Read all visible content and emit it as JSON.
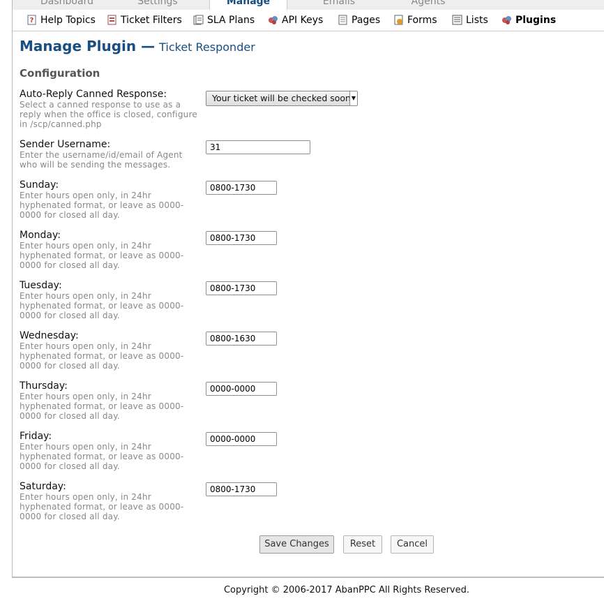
{
  "tabs": [
    {
      "label": "Dashboard"
    },
    {
      "label": "Settings"
    },
    {
      "label": "Manage",
      "active": true
    },
    {
      "label": "Emails"
    },
    {
      "label": "Agents"
    }
  ],
  "subnav": [
    {
      "label": "Help Topics",
      "icon": "help-topics-icon"
    },
    {
      "label": "Ticket Filters",
      "icon": "ticket-filters-icon"
    },
    {
      "label": "SLA Plans",
      "icon": "sla-plans-icon"
    },
    {
      "label": "API Keys",
      "icon": "api-keys-icon"
    },
    {
      "label": "Pages",
      "icon": "pages-icon"
    },
    {
      "label": "Forms",
      "icon": "forms-icon"
    },
    {
      "label": "Lists",
      "icon": "lists-icon"
    },
    {
      "label": "Plugins",
      "icon": "plugins-icon",
      "active": true
    }
  ],
  "page": {
    "title": "Manage Plugin —",
    "subtitle": "Ticket Responder",
    "section": "Configuration"
  },
  "fields": {
    "auto_reply": {
      "label": "Auto-Reply Canned Response:",
      "hint": "Select a canned response to use as a reply when the office is closed, configure in /scp/canned.php",
      "value": "Your ticket will be checked soon"
    },
    "sender": {
      "label": "Sender Username:",
      "hint": "Enter the username/id/email of Agent who will be sending the messages.",
      "value": "31"
    },
    "days": [
      {
        "label": "Sunday:",
        "value": "0800-1730"
      },
      {
        "label": "Monday:",
        "value": "0800-1730"
      },
      {
        "label": "Tuesday:",
        "value": "0800-1730"
      },
      {
        "label": "Wednesday:",
        "value": "0800-1630"
      },
      {
        "label": "Thursday:",
        "value": "0000-0000"
      },
      {
        "label": "Friday:",
        "value": "0000-0000"
      },
      {
        "label": "Saturday:",
        "value": "0800-1730"
      }
    ],
    "day_hint": "Enter hours open only, in 24hr hyphenated format, or leave as 0000-0000 for closed all day."
  },
  "buttons": {
    "save": "Save Changes",
    "reset": "Reset",
    "cancel": "Cancel"
  },
  "footer": "Copyright © 2006-2017 AbanPPC All Rights Reserved."
}
